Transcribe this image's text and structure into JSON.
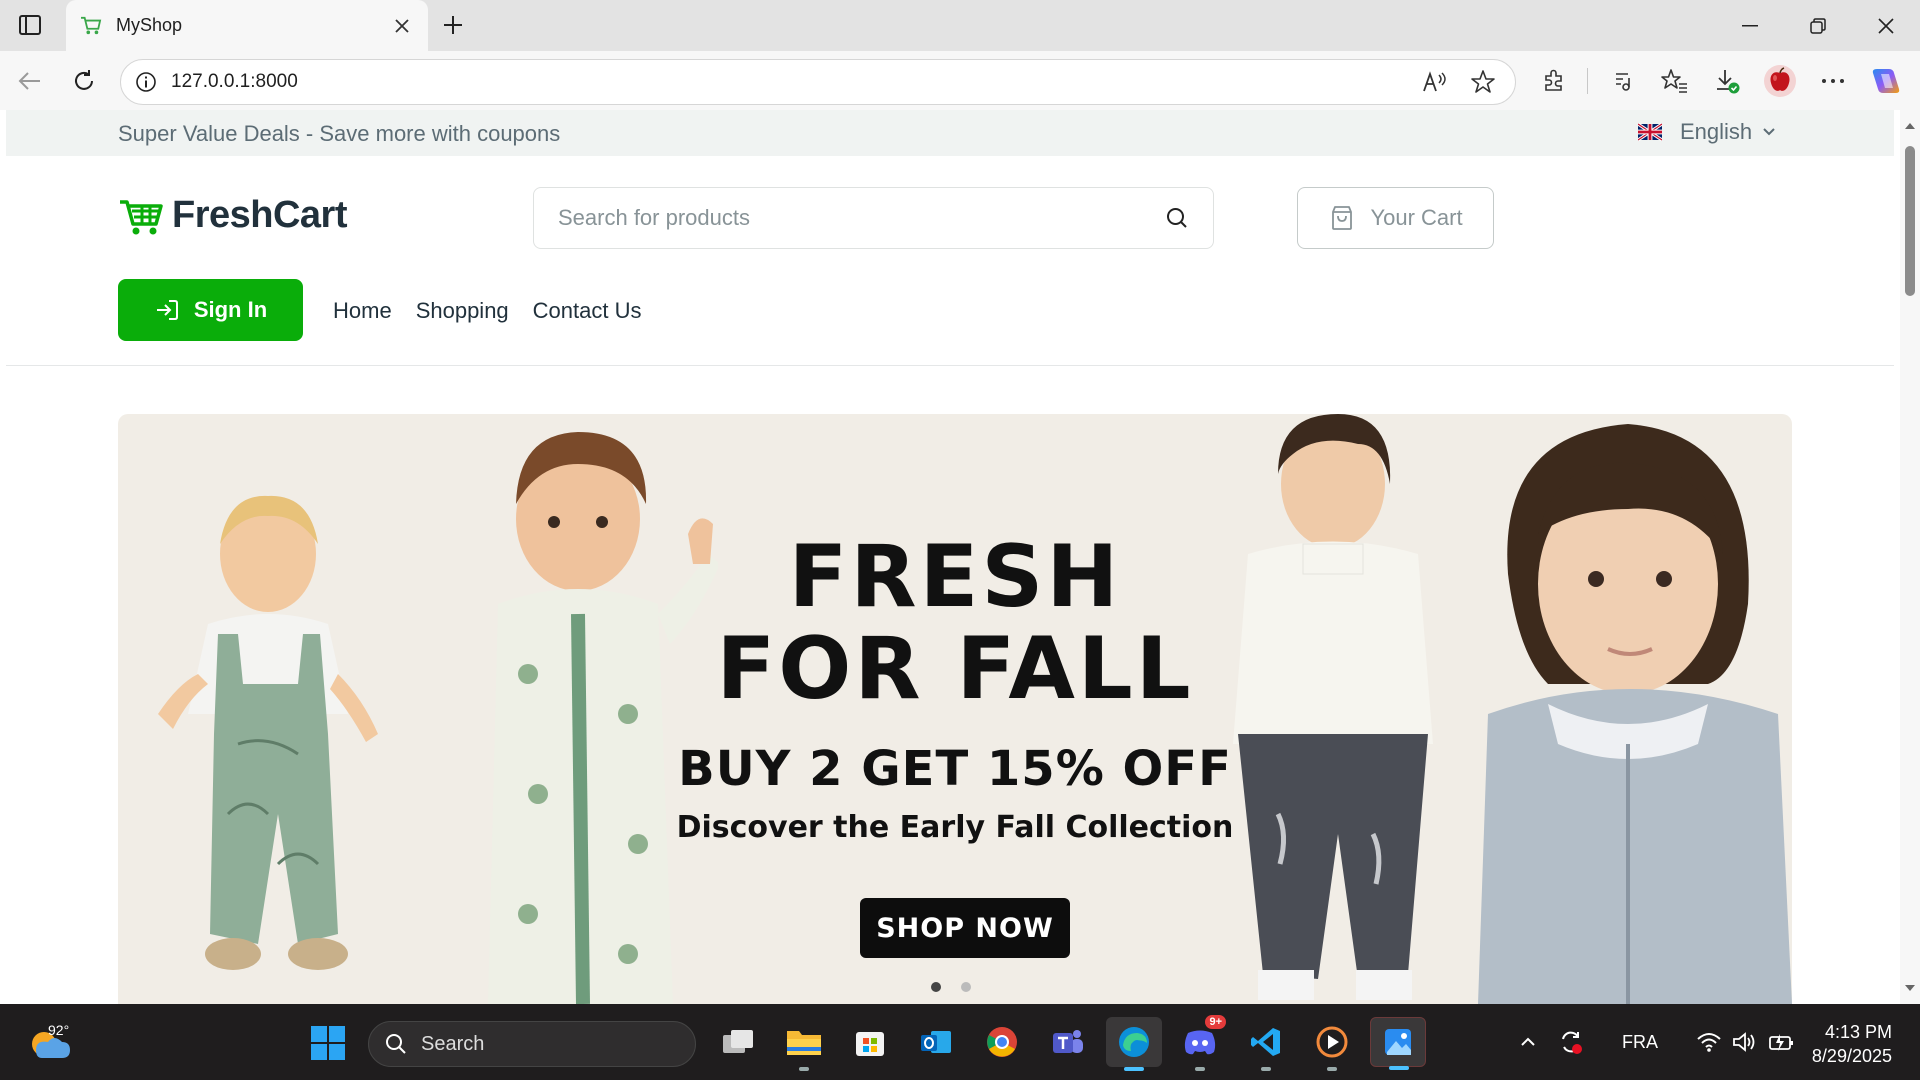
{
  "browser": {
    "tab_title": "MyShop",
    "url": "127.0.0.1:8000"
  },
  "topbar": {
    "deals_text": "Super Value Deals - Save more with coupons",
    "language": "English"
  },
  "header": {
    "logo_text": "FreshCart",
    "search_placeholder": "Search for products",
    "cart_label": "Your Cart",
    "signin_label": "Sign In"
  },
  "nav": {
    "items": [
      {
        "label": "Home"
      },
      {
        "label": "Shopping"
      },
      {
        "label": "Contact Us"
      }
    ]
  },
  "hero": {
    "title_line1": "FRESH",
    "title_line2": "FOR FALL",
    "offer": "BUY 2 GET 15% OFF",
    "subtitle": "Discover the Early Fall Collection",
    "cta": "SHOP NOW",
    "slide_count": 2,
    "active_slide": 1,
    "background": "#f1ede6"
  },
  "taskbar": {
    "weather_temp": "92°",
    "search_label": "Search",
    "discord_badge": "9+",
    "input_language": "FRA",
    "time": "4:13 PM",
    "date": "8/29/2025"
  },
  "colors": {
    "brand_green": "#0aad0a",
    "text_dark": "#21313c",
    "text_muted": "#5c6c75"
  }
}
